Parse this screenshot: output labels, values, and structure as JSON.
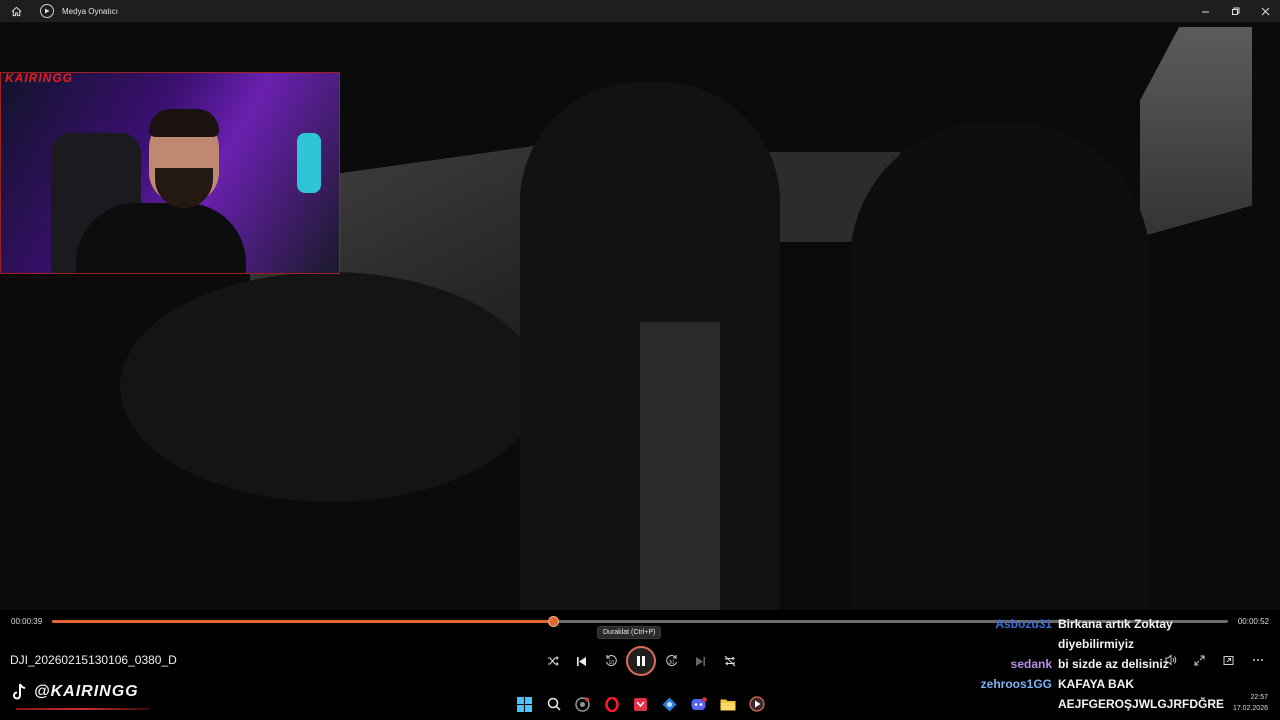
{
  "window": {
    "title": "Medya Oynatıcı",
    "home_icon": "home-icon",
    "app_icon": "media-player-icon",
    "controls": [
      "minimize-icon",
      "restore-icon",
      "close-icon"
    ]
  },
  "webcam_overlay": {
    "label": "KAIRINGG"
  },
  "playback": {
    "current_time": "00:00:39",
    "total_time": "00:00:52",
    "progress_percent": 42.6,
    "accent_color": "#e0692f",
    "file_name": "DJI_20260215130106_0380_D",
    "tooltip": "Duraklat (Ctrl+P)",
    "state": "playing"
  },
  "controls": {
    "shuffle_icon": "shuffle-icon",
    "previous_icon": "skip-previous-icon",
    "rewind_label": "10",
    "pause_icon": "pause-icon",
    "forward_label": "30",
    "next_icon": "skip-next-icon",
    "repeat_icon": "repeat-off-icon"
  },
  "right_controls": [
    "volume-icon",
    "fullscreen-icon",
    "mini-player-icon",
    "more-icon"
  ],
  "chat": [
    {
      "user": "Asbozu31",
      "message": "Birkana artık Zoktay",
      "color": "#3b6fd8"
    },
    {
      "user": "",
      "message": "diyebilirmiyiz",
      "color": "#3b6fd8"
    },
    {
      "user": "sedank",
      "message": "bi sizde az delisiniz",
      "color": "#b592e8"
    },
    {
      "user": "zehroos1GG",
      "message": "KAFAYA BAK",
      "color": "#7eb3f5"
    },
    {
      "user": "",
      "message": "AEJFGEROŞJWLGJRFDĞRE",
      "color": "#7eb3f5"
    }
  ],
  "overlay_handle": {
    "text": "@KAIRINGG",
    "icon": "tiktok-icon"
  },
  "taskbar": {
    "icons": [
      "windows-start-icon",
      "search-icon",
      "chrome-icon",
      "opera-icon",
      "app-red-icon",
      "settings-icon",
      "discord-icon",
      "file-explorer-icon",
      "media-player-icon"
    ],
    "time": "22:57",
    "date": "17.02.2026"
  }
}
